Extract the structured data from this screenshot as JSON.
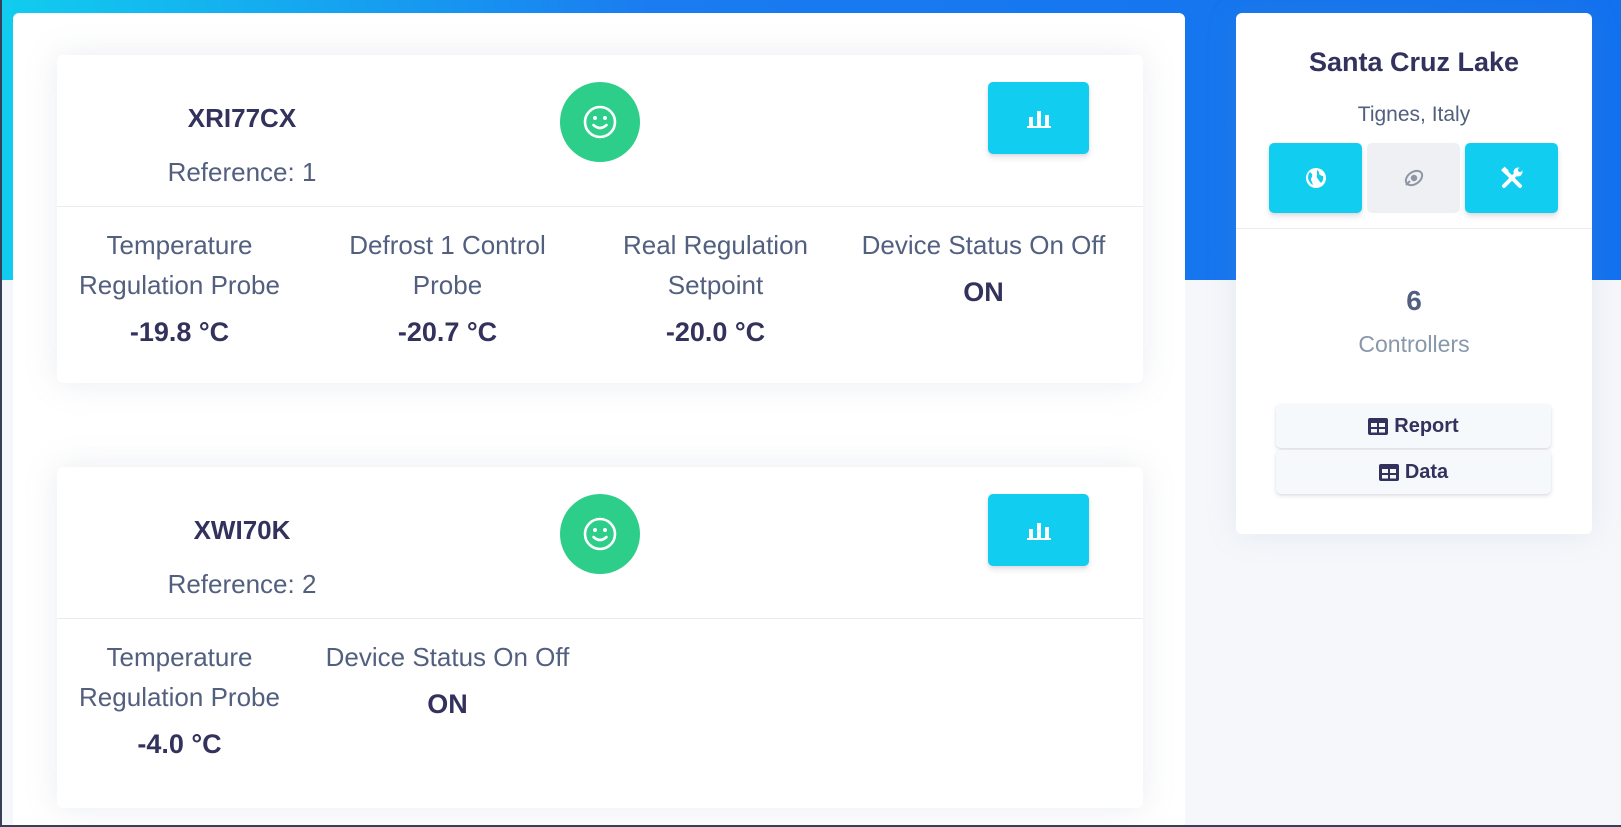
{
  "devices": [
    {
      "name": "XRI77CX",
      "reference": "Reference: 1",
      "status_icon": "smile-icon",
      "chart_icon": "bar-chart-icon",
      "metrics": [
        {
          "label": "Temperature Regulation Probe",
          "value": "-19.8 °C"
        },
        {
          "label": "Defrost 1 Control Probe",
          "value": "-20.7 °C"
        },
        {
          "label": "Real Regulation Setpoint",
          "value": "-20.0 °C"
        },
        {
          "label": "Device Status On Off",
          "value": "ON"
        }
      ]
    },
    {
      "name": "XWI70K",
      "reference": "Reference: 2",
      "status_icon": "smile-icon",
      "chart_icon": "bar-chart-icon",
      "metrics": [
        {
          "label": "Temperature Regulation Probe",
          "value": "-4.0 °C"
        },
        {
          "label": "Device Status On Off",
          "value": "ON"
        }
      ]
    }
  ],
  "site": {
    "name": "Santa Cruz Lake",
    "location": "Tignes, Italy",
    "buttons": [
      {
        "icon": "globe-icon",
        "style": "cyan"
      },
      {
        "icon": "satellite-icon",
        "style": "grey"
      },
      {
        "icon": "tools-icon",
        "style": "cyan"
      }
    ],
    "controllers_count": "6",
    "controllers_label": "Controllers",
    "report_label": "Report",
    "data_label": "Data"
  },
  "colors": {
    "primary": "#11cdef",
    "success": "#2dce89",
    "header_gradient_end": "#1171ef",
    "text_dark": "#32325d"
  }
}
